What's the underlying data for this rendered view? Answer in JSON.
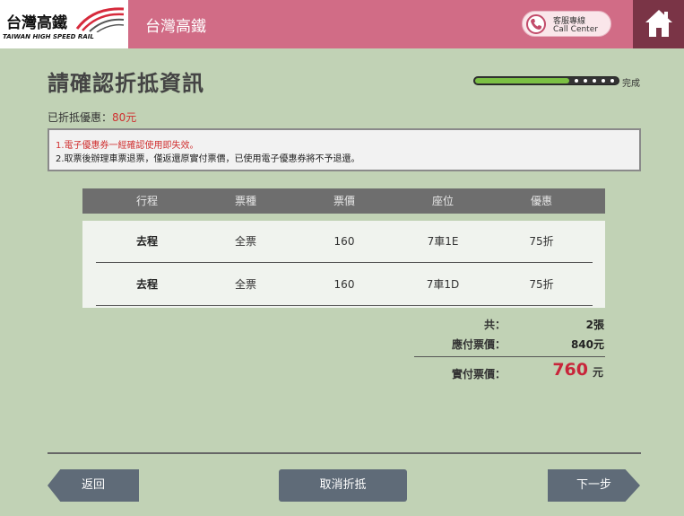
{
  "header": {
    "logo_zh": "台灣高鐵",
    "logo_en": "TAIWAN HIGH SPEED RAIL",
    "title": "台灣高鐵",
    "call_zh": "客服專線",
    "call_en": "Call Center",
    "home_icon": "home-icon",
    "phone_icon": "phone-icon"
  },
  "page": {
    "title": "請確認折抵資訊",
    "progress_label": "完成",
    "progress": 1.0
  },
  "discount": {
    "label": "已折抵優惠：",
    "value": "80元"
  },
  "notice": {
    "line1": "1.電子優惠券一經確認使用即失效。",
    "line2": "2.取票後辦理車票退票，僅返還原實付票價，已使用電子優惠券將不予退還。"
  },
  "table": {
    "headers": [
      "行程",
      "票種",
      "票價",
      "座位",
      "優惠"
    ],
    "rows": [
      [
        "去程",
        "全票",
        "160",
        "7車1E",
        "75折"
      ],
      [
        "去程",
        "全票",
        "160",
        "7車1D",
        "75折"
      ]
    ]
  },
  "summary": {
    "count_label": "共：",
    "count_value": "2張",
    "due_label": "應付票價：",
    "due_value": "840元",
    "paid_label": "實付票價：",
    "paid_value": "760",
    "paid_unit": "元"
  },
  "buttons": {
    "back": "返回",
    "cancel": "取消折抵",
    "next": "下一步"
  },
  "colors": {
    "header": "#d16c86",
    "home": "#7a3446",
    "background": "#c1d2b5",
    "accent_red": "#c8253a",
    "button": "#5f6b78"
  }
}
